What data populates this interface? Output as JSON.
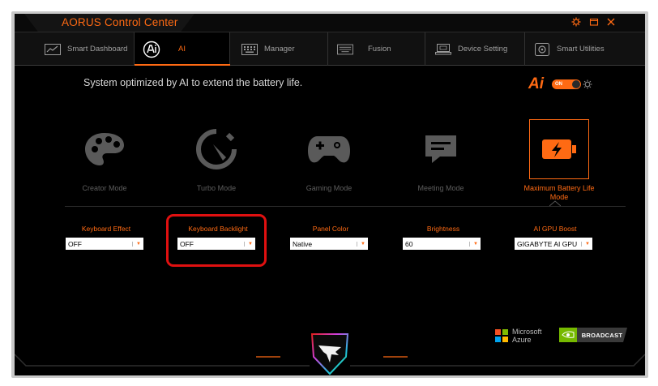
{
  "window": {
    "title": "AORUS Control Center",
    "controls": [
      {
        "name": "settings-gear-icon"
      },
      {
        "name": "restore-icon"
      },
      {
        "name": "close-icon"
      }
    ]
  },
  "tabs": [
    {
      "label": "Smart Dashboard",
      "icon": "dashboard-icon"
    },
    {
      "label": "AI",
      "icon": "ai-icon",
      "active": true
    },
    {
      "label": "Manager",
      "icon": "keyboard-manager-icon"
    },
    {
      "label": "Fusion",
      "icon": "keyboard-fusion-icon"
    },
    {
      "label": "Device Setting",
      "icon": "laptop-icon"
    },
    {
      "label": "Smart Utilities",
      "icon": "utilities-icon"
    }
  ],
  "status": {
    "message": "System optimized by AI to extend the battery life.",
    "ai_logo": "Ai",
    "toggle_label": "ON",
    "toggle_on": true
  },
  "modes": [
    {
      "label": "Creator Mode",
      "icon": "palette-icon"
    },
    {
      "label": "Turbo Mode",
      "icon": "speedometer-icon"
    },
    {
      "label": "Gaming Mode",
      "icon": "gamepad-icon"
    },
    {
      "label": "Meeting Mode",
      "icon": "chat-bubble-icon"
    },
    {
      "label": "Maximum Battery Life Mode",
      "icon": "battery-charging-icon",
      "active": true
    }
  ],
  "settings": [
    {
      "label": "Keyboard Effect",
      "value": "OFF"
    },
    {
      "label": "Keyboard Backlight",
      "value": "OFF"
    },
    {
      "label": "Panel Color",
      "value": "Native"
    },
    {
      "label": "Brightness",
      "value": "60"
    },
    {
      "label": "AI GPU Boost",
      "value": "GIGABYTE AI GPU"
    }
  ],
  "logos": {
    "microsoft_line1": "Microsoft",
    "microsoft_line2": "Azure",
    "nvidia_label": "BROADCAST"
  },
  "colors": {
    "accent": "#ff6a13",
    "highlight": "#e01010",
    "inactive": "#5e5e5e"
  }
}
